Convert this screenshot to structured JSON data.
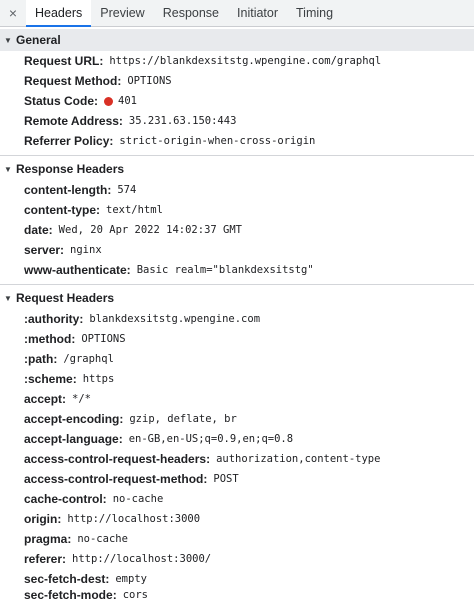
{
  "tabs": {
    "close": "×",
    "items": [
      {
        "label": "Headers",
        "active": true
      },
      {
        "label": "Preview"
      },
      {
        "label": "Response"
      },
      {
        "label": "Initiator"
      },
      {
        "label": "Timing"
      }
    ]
  },
  "general": {
    "title": "General",
    "rows": [
      {
        "key": "Request URL:",
        "value": "https://blankdexsitstg.wpengine.com/graphql"
      },
      {
        "key": "Request Method:",
        "value": "OPTIONS"
      },
      {
        "key": "Status Code:",
        "value": "401",
        "status_color": "#d93025"
      },
      {
        "key": "Remote Address:",
        "value": "35.231.63.150:443"
      },
      {
        "key": "Referrer Policy:",
        "value": "strict-origin-when-cross-origin"
      }
    ]
  },
  "response_headers": {
    "title": "Response Headers",
    "rows": [
      {
        "key": "content-length:",
        "value": "574"
      },
      {
        "key": "content-type:",
        "value": "text/html"
      },
      {
        "key": "date:",
        "value": "Wed, 20 Apr 2022 14:02:37 GMT"
      },
      {
        "key": "server:",
        "value": "nginx"
      },
      {
        "key": "www-authenticate:",
        "value": "Basic realm=\"blankdexsitstg\""
      }
    ]
  },
  "request_headers": {
    "title": "Request Headers",
    "rows": [
      {
        "key": ":authority:",
        "value": "blankdexsitstg.wpengine.com"
      },
      {
        "key": ":method:",
        "value": "OPTIONS"
      },
      {
        "key": ":path:",
        "value": "/graphql"
      },
      {
        "key": ":scheme:",
        "value": "https"
      },
      {
        "key": "accept:",
        "value": "*/*"
      },
      {
        "key": "accept-encoding:",
        "value": "gzip, deflate, br"
      },
      {
        "key": "accept-language:",
        "value": "en-GB,en-US;q=0.9,en;q=0.8"
      },
      {
        "key": "access-control-request-headers:",
        "value": "authorization,content-type"
      },
      {
        "key": "access-control-request-method:",
        "value": "POST"
      },
      {
        "key": "cache-control:",
        "value": "no-cache"
      },
      {
        "key": "origin:",
        "value": "http://localhost:3000"
      },
      {
        "key": "pragma:",
        "value": "no-cache"
      },
      {
        "key": "referer:",
        "value": "http://localhost:3000/"
      },
      {
        "key": "sec-fetch-dest:",
        "value": "empty"
      },
      {
        "key": "sec-fetch-mode:",
        "value": "cors"
      }
    ]
  }
}
